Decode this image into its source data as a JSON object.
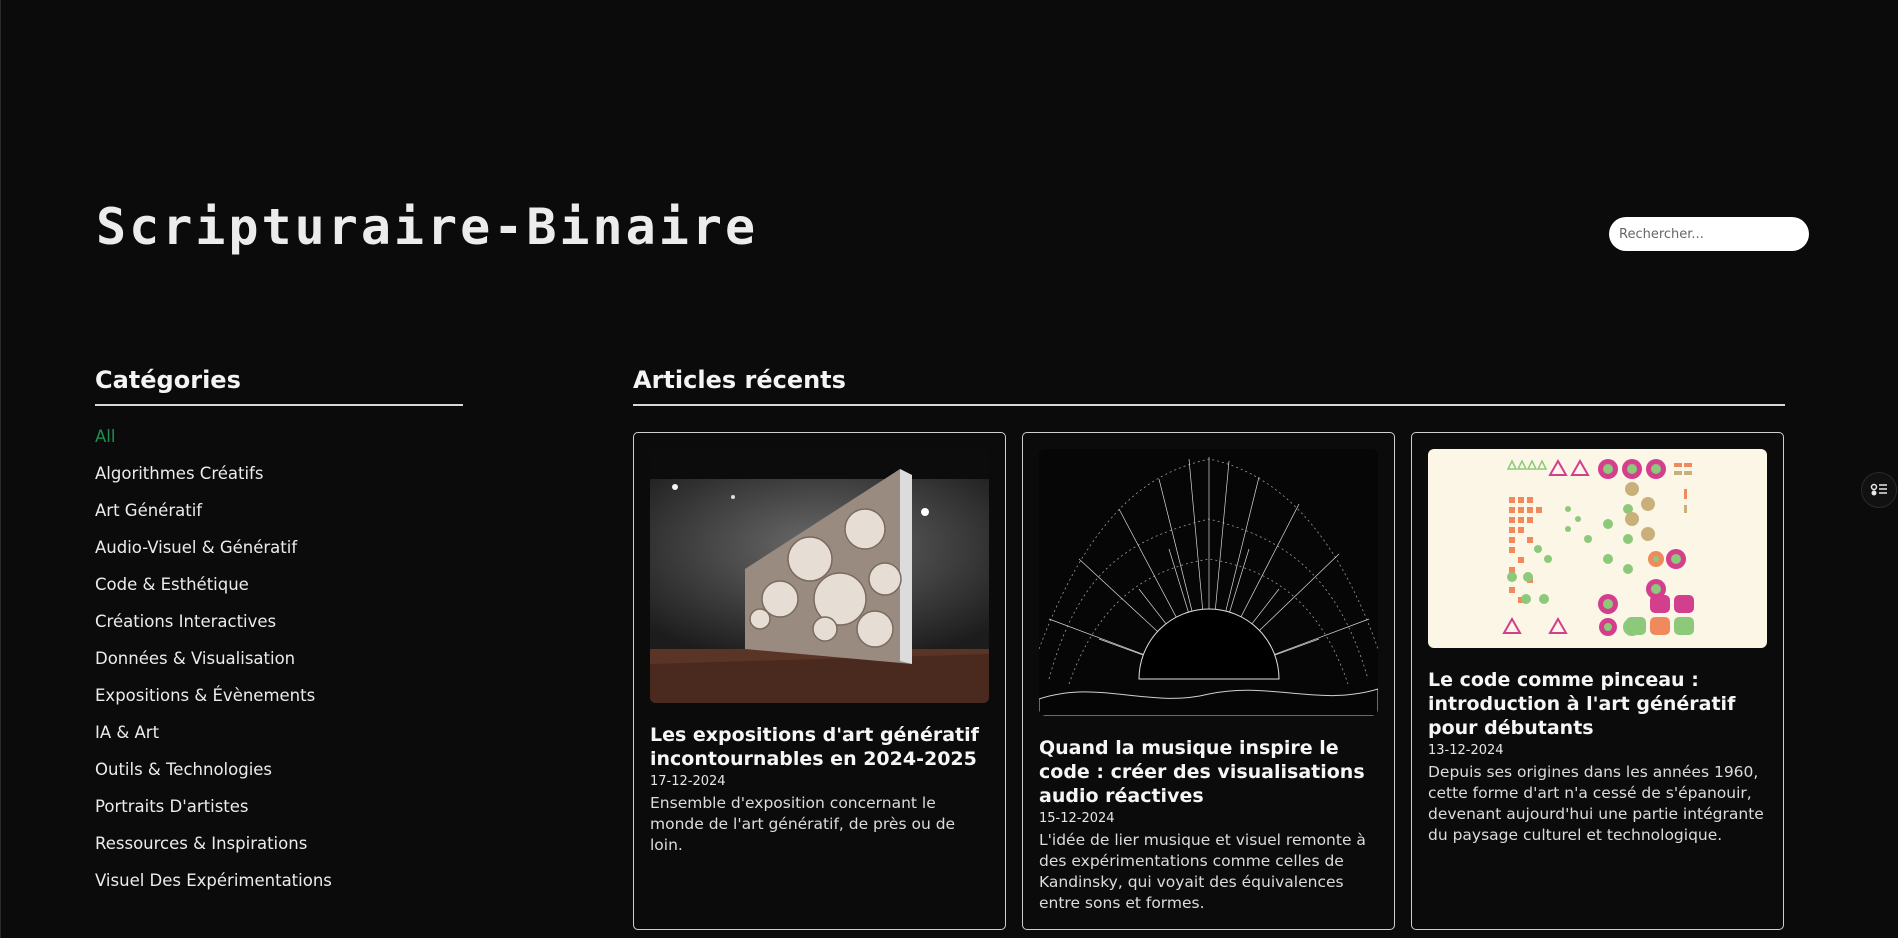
{
  "site": {
    "title": "Scripturaire-Binaire",
    "search_placeholder": "Rechercher..."
  },
  "sidebar": {
    "heading": "Catégories",
    "items": [
      {
        "label": "All",
        "active": true
      },
      {
        "label": "Algorithmes Créatifs"
      },
      {
        "label": "Art Génératif"
      },
      {
        "label": "Audio-Visuel & Génératif"
      },
      {
        "label": "Code & Esthétique"
      },
      {
        "label": "Créations Interactives"
      },
      {
        "label": "Données & Visualisation"
      },
      {
        "label": "Expositions & Évènements"
      },
      {
        "label": "IA & Art"
      },
      {
        "label": "Outils & Technologies"
      },
      {
        "label": "Portraits D'artistes"
      },
      {
        "label": "Ressources & Inspirations"
      },
      {
        "label": "Visuel Des Expérimentations"
      }
    ]
  },
  "main": {
    "heading": "Articles récents",
    "articles": [
      {
        "title": "Les expositions d'art génératif incontournables en 2024-2025",
        "date": "17-12-2024",
        "excerpt": "Ensemble d'exposition concernant le monde de l'art génératif, de près ou de loin.",
        "image_icon": "gallery-exhibition-image"
      },
      {
        "title": "Quand la musique inspire le code : créer des visualisations audio réactives",
        "date": "15-12-2024",
        "excerpt": "L'idée de lier musique et visuel remonte à des expérimentations comme celles de Kandinsky, qui voyait des équivalences entre sons et formes.",
        "image_icon": "audio-waveform-image"
      },
      {
        "title": "Le code comme pinceau : introduction à l'art génératif pour débutants",
        "date": "13-12-2024",
        "excerpt": "Depuis ses origines dans les années 1960, cette forme d'art n'a cessé de s'épanouir, devenant aujourd'hui une partie intégrante du paysage culturel et technologique.",
        "image_icon": "geometric-pattern-image"
      }
    ]
  },
  "colors": {
    "background": "#0b0b0b",
    "active_category": "#1f8f52",
    "text": "#f2f2f2"
  }
}
